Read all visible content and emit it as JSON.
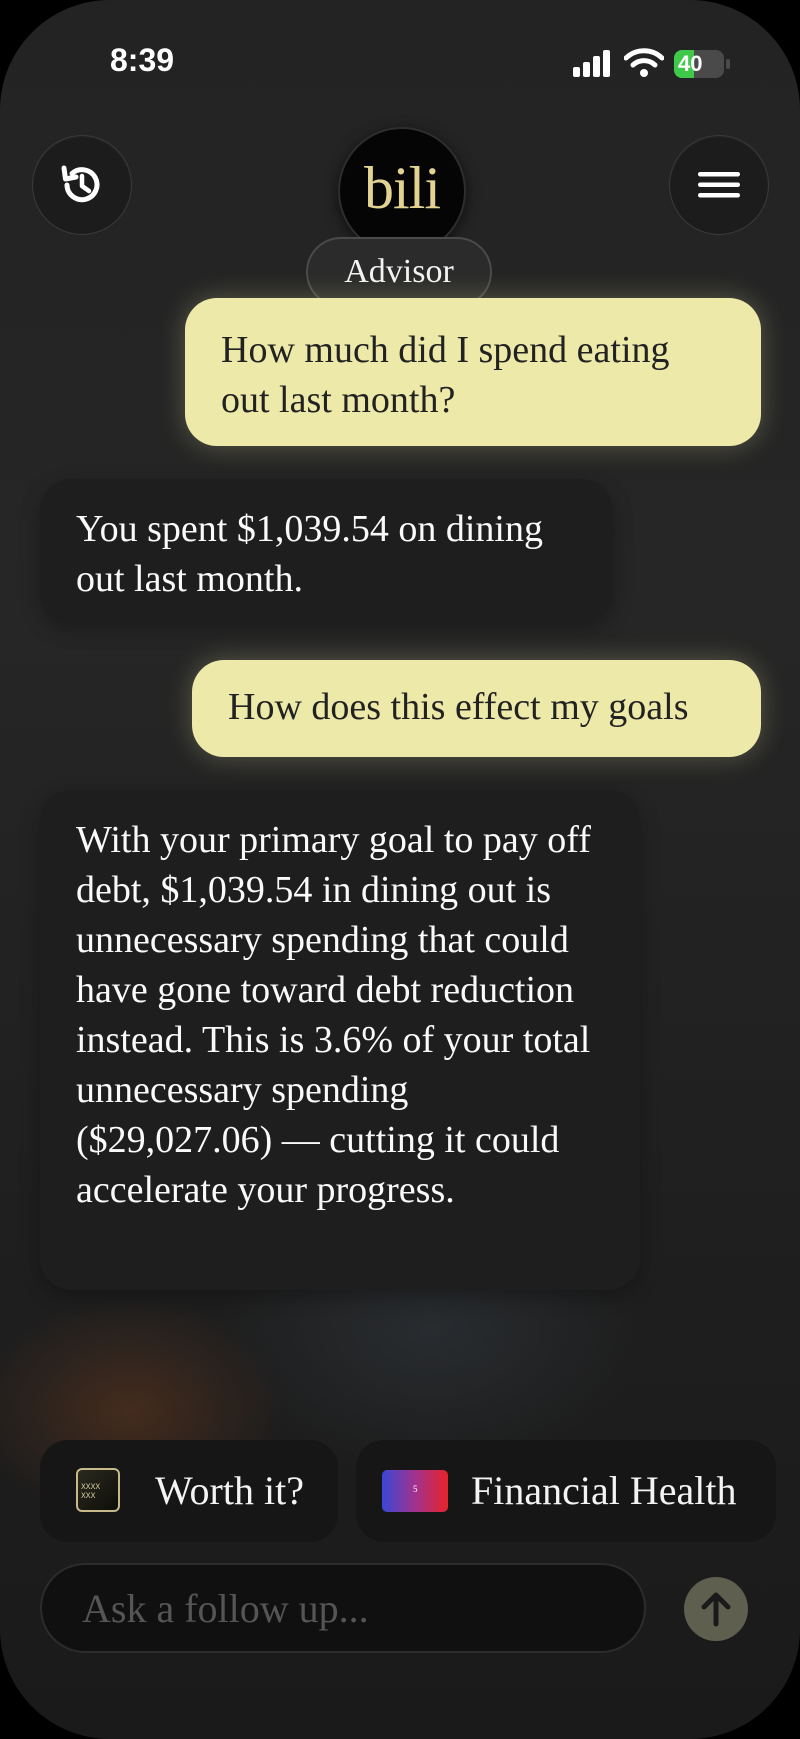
{
  "status_bar": {
    "time": "8:39",
    "battery": "40",
    "battery_level": 0.4
  },
  "header": {
    "logo_text": "bili",
    "advisor_label": "Advisor",
    "history_icon": "history-icon",
    "menu_icon": "hamburger-menu-icon"
  },
  "messages": [
    {
      "role": "user",
      "text": "How much did I spend eating out last month?"
    },
    {
      "role": "assistant",
      "text": "You spent $1,039.54 on dining out last month."
    },
    {
      "role": "user",
      "text": "How does this effect my goals"
    },
    {
      "role": "assistant",
      "text": "With your primary goal to pay off debt, $1,039.54 in dining out is unnecessary spending that could have gone toward debt reduction instead. This is 3.6% of your total unnecessary spending ($29,027.06) — cutting it could accelerate your progress."
    }
  ],
  "suggestions": [
    {
      "label": "Worth it?",
      "thumb_text": "XXXX XXX"
    },
    {
      "label": "Financial Health",
      "thumb_text": "5"
    }
  ],
  "composer": {
    "placeholder": "Ask a follow up...",
    "send_icon": "arrow-up-icon"
  },
  "colors": {
    "user_bubble": "#ede9a9",
    "assistant_bubble": "#1e1e1e",
    "logo_gold": "#e2d392"
  }
}
